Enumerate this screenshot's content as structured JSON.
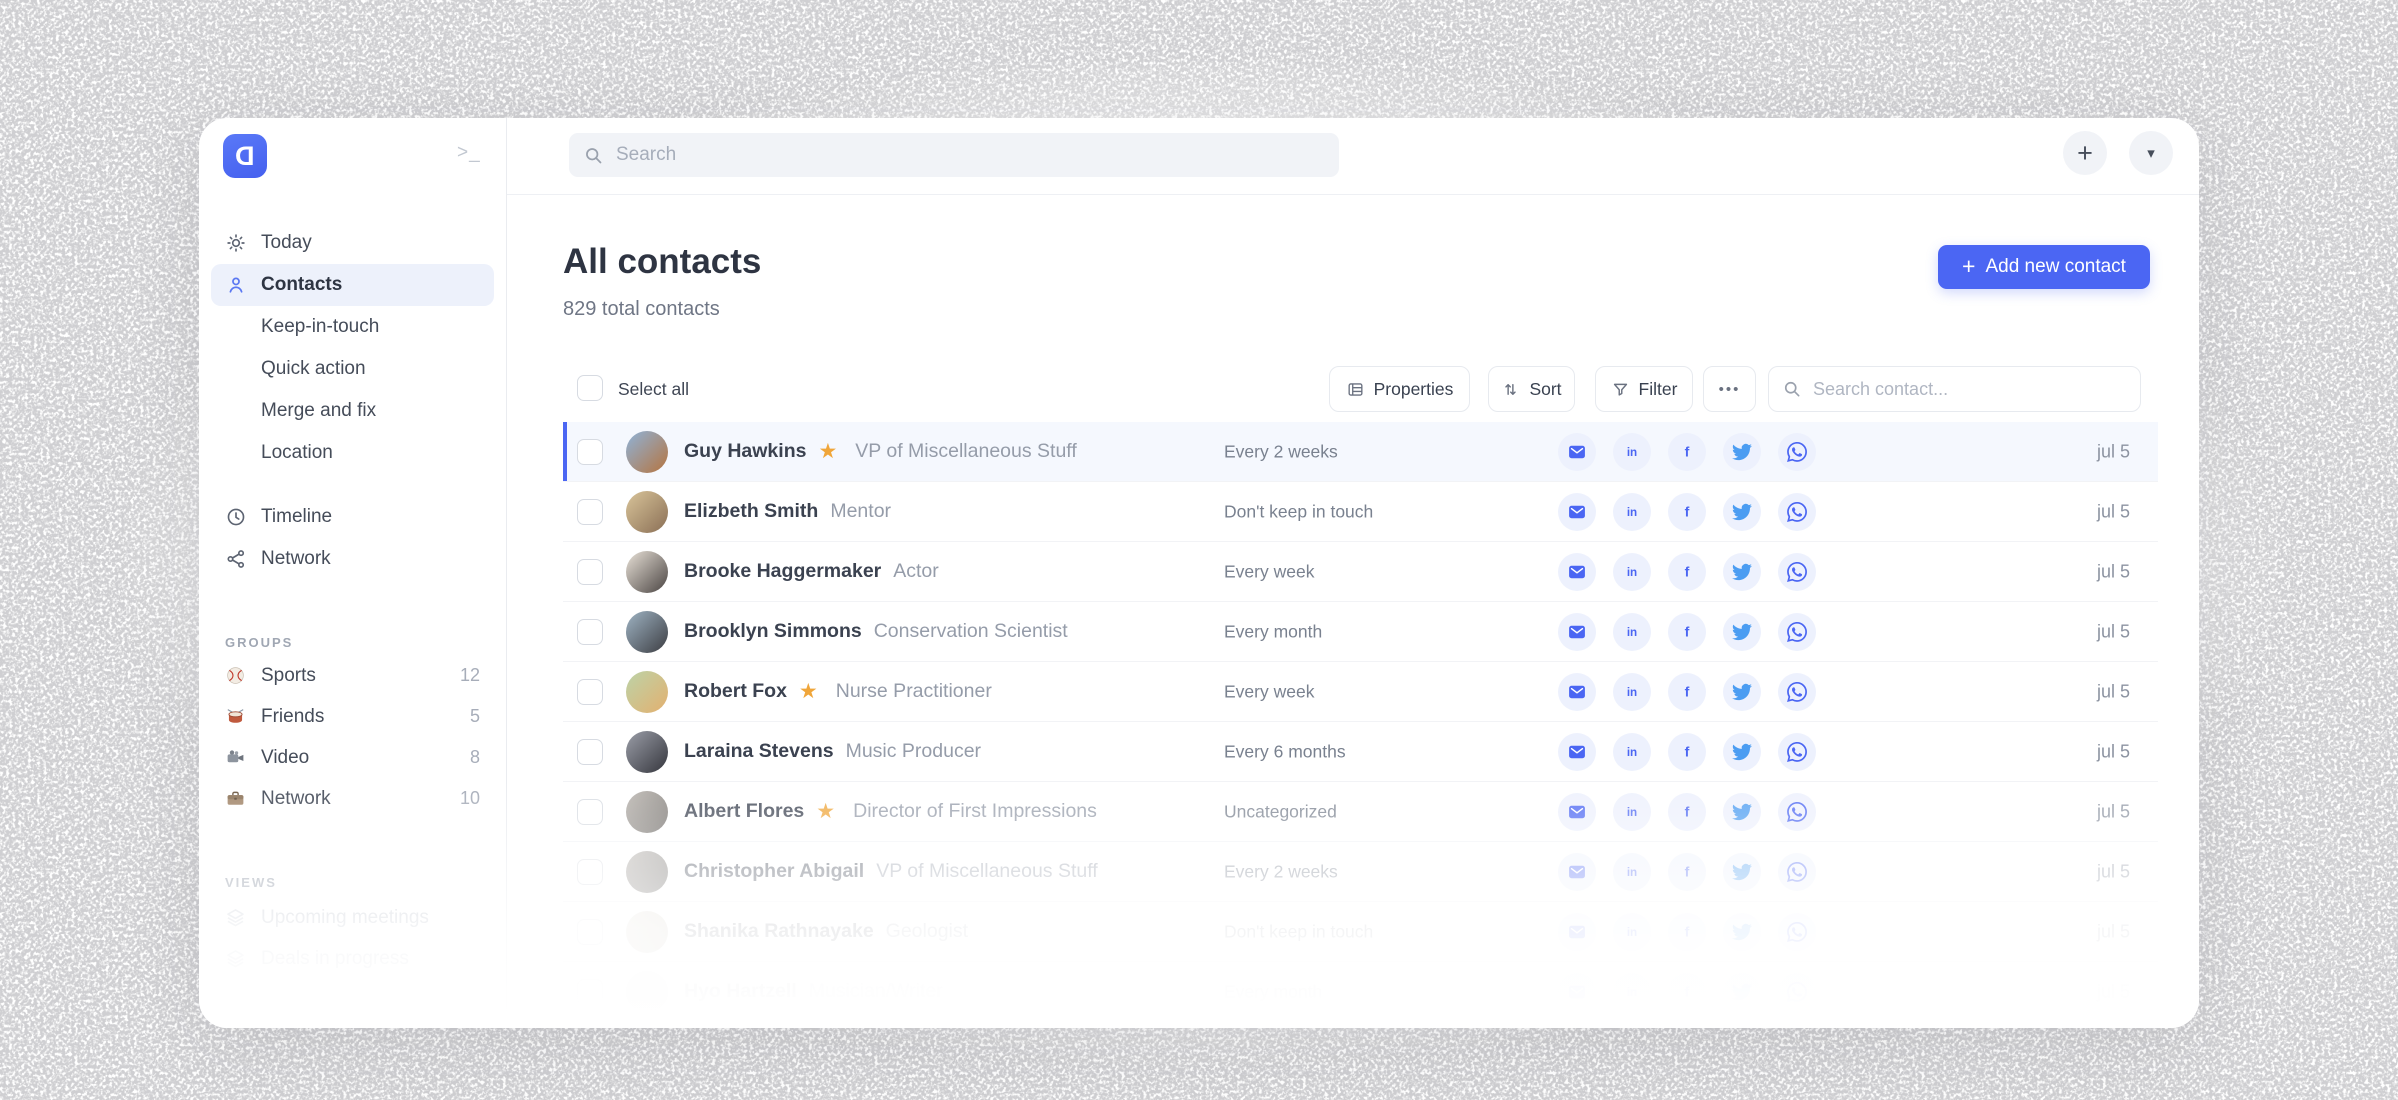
{
  "colors": {
    "accent": "#4b66f3",
    "star": "#f0a63a",
    "twitter_blue": "#4b9df2",
    "icon_circle_bg": "#edf1fd",
    "selected_row_bg": "#f5f8fe"
  },
  "window": {
    "sidebar": {
      "logo_letter": "D",
      "collapse_icon_label": ">_",
      "nav": [
        {
          "label": "Today",
          "icon": "sun-icon"
        },
        {
          "label": "Contacts",
          "icon": "person-icon",
          "active": true
        },
        {
          "label": "Keep-in-touch",
          "indent": true
        },
        {
          "label": "Quick action",
          "indent": true
        },
        {
          "label": "Merge and fix",
          "indent": true
        },
        {
          "label": "Location",
          "indent": true
        },
        {
          "label": "Timeline",
          "icon": "clock-icon",
          "gap_before": true
        },
        {
          "label": "Network",
          "icon": "share-icon"
        }
      ],
      "groups": {
        "heading": "GROUPS",
        "items": [
          {
            "icon": "baseball-icon",
            "label": "Sports",
            "count": "12"
          },
          {
            "icon": "drum-icon",
            "label": "Friends",
            "count": "5"
          },
          {
            "icon": "camcorder-icon",
            "label": "Video",
            "count": "8"
          },
          {
            "icon": "briefcase-icon",
            "label": "Network",
            "count": "10"
          }
        ]
      },
      "views": {
        "heading": "VIEWS",
        "items": [
          {
            "icon": "layers-icon",
            "label": "Upcoming meetings"
          },
          {
            "icon": "layers-icon",
            "label": "Deals in progress"
          }
        ]
      }
    },
    "topbar": {
      "search_placeholder": "Search"
    },
    "header": {
      "title": "All contacts",
      "subtitle": "829 total contacts",
      "add_contact_label": "Add new contact",
      "add_contact_plus": "+"
    },
    "toolbar": {
      "select_all_label": "Select all",
      "properties_label": "Properties",
      "sort_label": "Sort",
      "filter_label": "Filter",
      "more_label": "•••",
      "search_placeholder": "Search contact..."
    },
    "topbar_buttons": {
      "plus": "+",
      "caret": "▾"
    },
    "list": {
      "social_icons": [
        "email",
        "linkedin",
        "facebook",
        "twitter",
        "whatsapp"
      ],
      "contacts": [
        {
          "name": "Guy Hawkins",
          "starred": true,
          "title": "VP of Miscellaneous Stuff",
          "frequency": "Every 2 weeks",
          "date": "jul 5",
          "selected": true,
          "fade": 1,
          "avatar": [
            "#8fb3d9",
            "#b5743f"
          ]
        },
        {
          "name": "Elizbeth Smith",
          "starred": false,
          "title": "Mentor",
          "frequency": "Don't keep in touch",
          "date": "jul 5",
          "selected": false,
          "fade": 1,
          "avatar": [
            "#d9c49a",
            "#8a6f55"
          ]
        },
        {
          "name": "Brooke Haggermaker",
          "starred": false,
          "title": "Actor",
          "frequency": "Every week",
          "date": "jul 5",
          "selected": false,
          "fade": 1,
          "avatar": [
            "#e9e2d8",
            "#4a4442"
          ]
        },
        {
          "name": "Brooklyn Simmons",
          "starred": false,
          "title": "Conservation Scientist",
          "frequency": "Every month",
          "date": "jul 5",
          "selected": false,
          "fade": 1,
          "avatar": [
            "#9fb4c4",
            "#3c3d42"
          ]
        },
        {
          "name": "Robert Fox",
          "starred": true,
          "title": "Nurse Practitioner",
          "frequency": "Every week",
          "date": "jul 5",
          "selected": false,
          "fade": 1,
          "avatar": [
            "#bcd3a8",
            "#e3b06f"
          ]
        },
        {
          "name": "Laraina Stevens",
          "starred": false,
          "title": "Music Producer",
          "frequency": "Every 6 months",
          "date": "jul 5",
          "selected": false,
          "fade": 1,
          "avatar": [
            "#9b9ea8",
            "#35363d"
          ]
        },
        {
          "name": "Albert Flores",
          "starred": true,
          "title": "Director of First Impressions",
          "frequency": "Uncategorized",
          "date": "jul 5",
          "selected": false,
          "fade": 0.88,
          "avatar": [
            "#bab5af",
            "#6b6763"
          ]
        },
        {
          "name": "Christopher Abigail",
          "starred": false,
          "title": "VP of Miscellaneous Stuff",
          "frequency": "Every 2 weeks",
          "date": "jul 5",
          "selected": false,
          "fade": 0.62,
          "avatar": [
            "#aaa49e",
            "#504d4a"
          ]
        },
        {
          "name": "Shanika Rathnayake",
          "starred": false,
          "title": "Geologist",
          "frequency": "Don't keep in touch",
          "date": "jul 5",
          "selected": false,
          "fade": 0.4,
          "avatar": [
            "#dcd5c8",
            "#a69d8c"
          ]
        },
        {
          "name": "Hyo Hartzell",
          "starred": false,
          "title": "Musician/Writer",
          "frequency": "Every month",
          "date": "jul 5",
          "selected": false,
          "fade": 0.22,
          "avatar": [
            "#d8d4ce",
            "#bfbab2"
          ]
        }
      ]
    }
  }
}
